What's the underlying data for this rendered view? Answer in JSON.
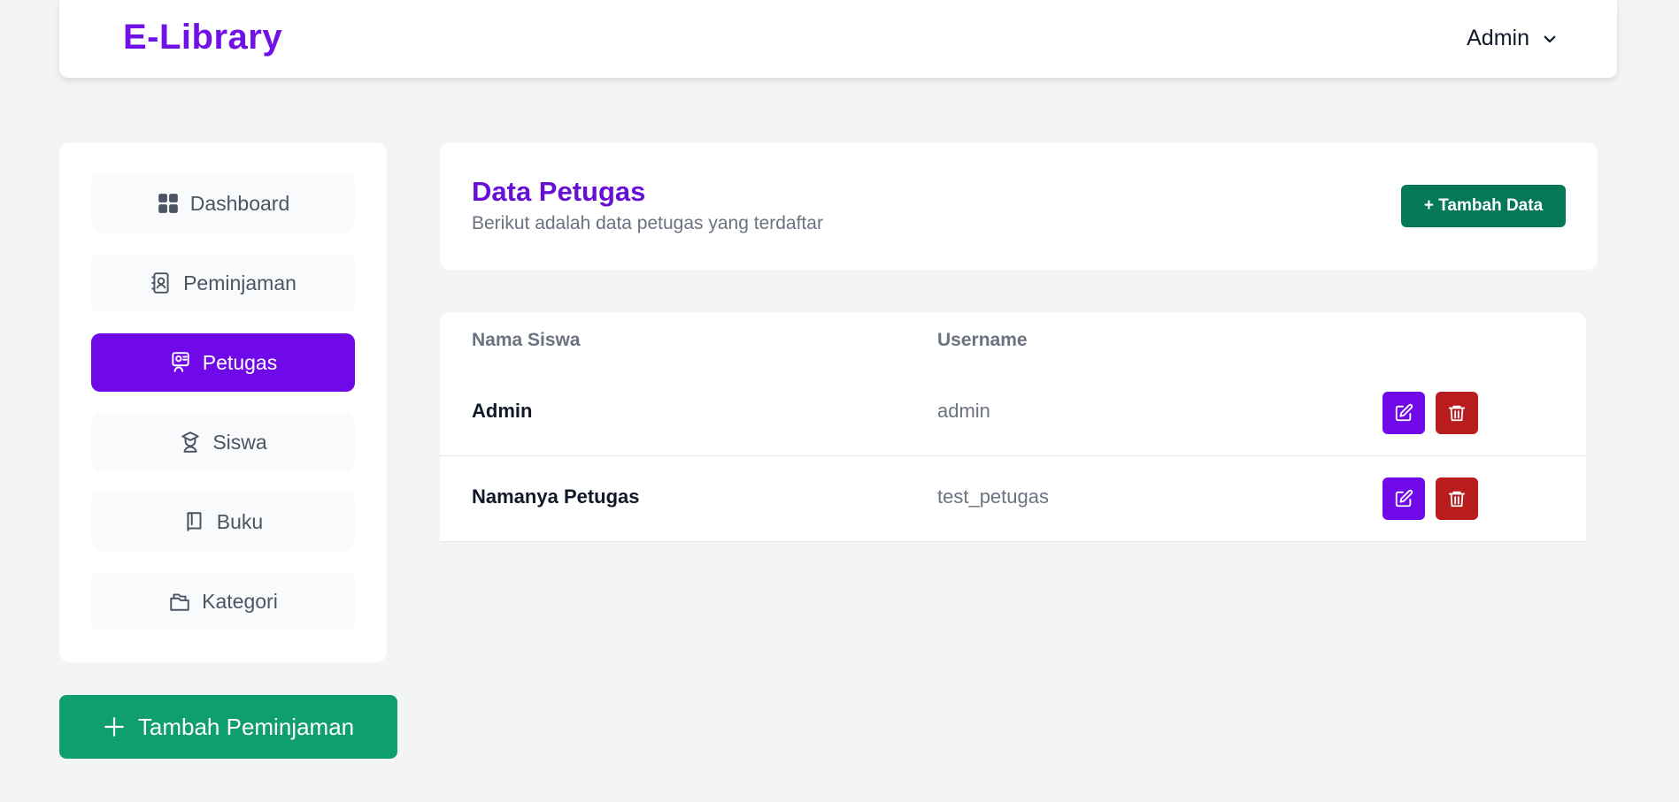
{
  "navbar": {
    "brand": "E-Library",
    "user_label": "Admin"
  },
  "sidebar": {
    "items": [
      {
        "label": "Dashboard",
        "icon": "dashboard-grid-icon"
      },
      {
        "label": "Peminjaman",
        "icon": "contact-book-icon"
      },
      {
        "label": "Petugas",
        "icon": "officer-icon",
        "active": true
      },
      {
        "label": "Siswa",
        "icon": "student-icon"
      },
      {
        "label": "Buku",
        "icon": "book-icon"
      },
      {
        "label": "Kategori",
        "icon": "folders-icon"
      }
    ],
    "cta_label": "Tambah Peminjaman"
  },
  "main": {
    "title": "Data Petugas",
    "subtitle": "Berikut adalah data petugas yang terdaftar",
    "add_button_label": "+ Tambah Data"
  },
  "table": {
    "columns": [
      "Nama Siswa",
      "Username"
    ],
    "rows": [
      {
        "name": "Admin",
        "username": "admin"
      },
      {
        "name": "Namanya Petugas",
        "username": "test_petugas"
      }
    ]
  },
  "colors": {
    "brand": "#7011e6",
    "active_nav": "#7009e8",
    "cta_green": "#0f9e6e",
    "add_green": "#047857",
    "edit_purple": "#7009e8",
    "delete_red": "#b91c1c"
  }
}
